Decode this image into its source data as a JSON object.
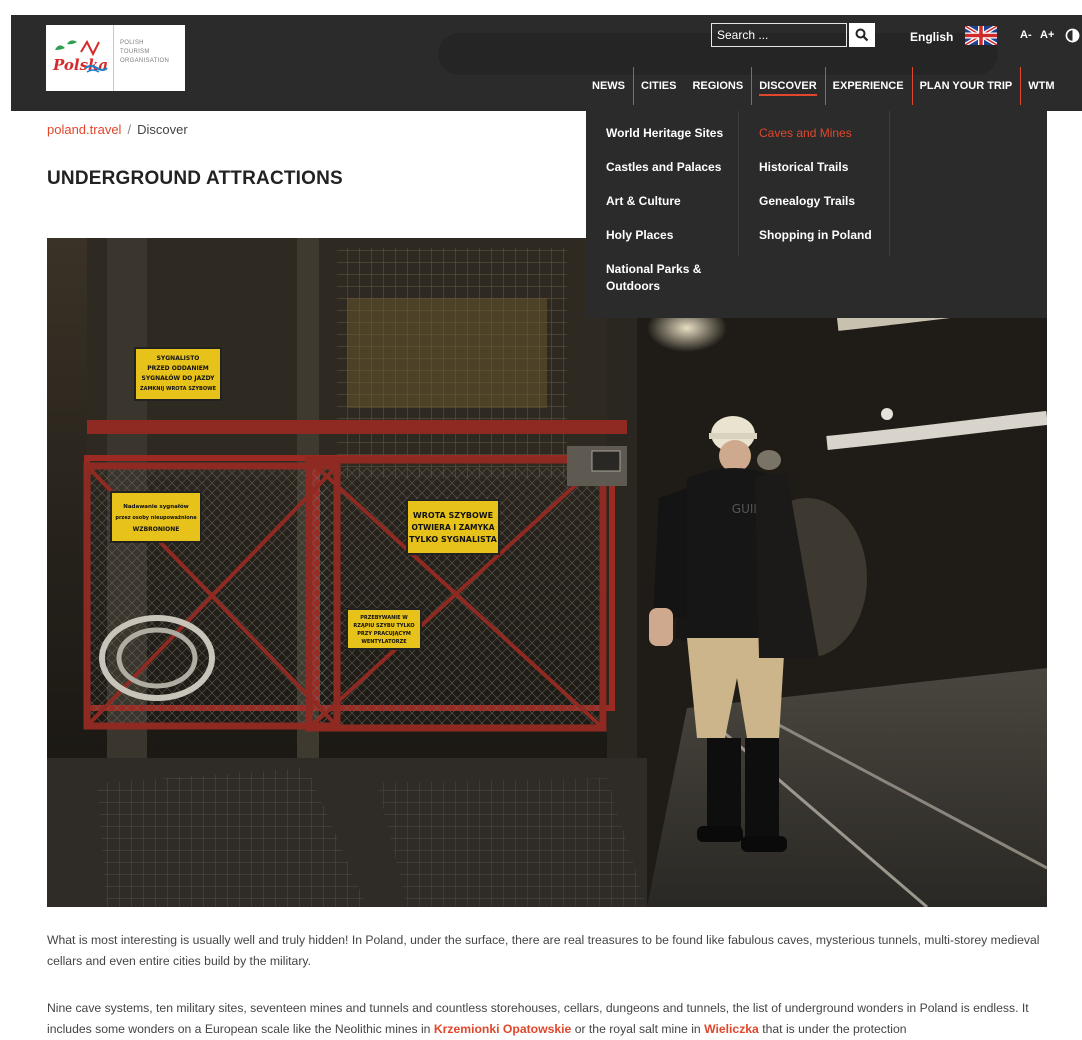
{
  "header": {
    "logo": {
      "brand_text": "Polska",
      "org_lines": [
        "POLISH",
        "TOURISM",
        "ORGANISATION"
      ]
    },
    "search": {
      "placeholder": "Search ...",
      "icon": "search-icon"
    },
    "language": "English",
    "language_flag_icon": "uk-flag-icon",
    "font_decrease": "A-",
    "font_increase": "A+",
    "contrast_icon": "contrast-icon",
    "nav": [
      "NEWS",
      "CITIES",
      "REGIONS",
      "DISCOVER",
      "EXPERIENCE",
      "PLAN YOUR TRIP",
      "WTM"
    ],
    "nav_active": "DISCOVER"
  },
  "dropdown": {
    "col1": [
      "World Heritage Sites",
      "Castles and Palaces",
      "Art & Culture",
      "Holy Places",
      "National Parks & Outdoors"
    ],
    "col2": [
      "Caves and Mines",
      "Historical Trails",
      "Genealogy Trails",
      "Shopping in Poland"
    ],
    "current": "Caves and Mines"
  },
  "breadcrumb": {
    "home": "poland.travel",
    "separator": "/",
    "current": "Discover"
  },
  "page_title": "UNDERGROUND ATTRACTIONS",
  "hero_signs": [
    [
      "SYGNALISTO",
      "PRZED ODDANIEM",
      "SYGNAŁÓW DO JAZDY",
      "ZAMKNIJ WROTA SZYBOWE"
    ],
    [
      "Nadawanie sygnałów",
      "przez osoby nieupoważnione",
      "WZBRONIONE"
    ],
    [
      "WROTA SZYBOWE",
      "OTWIERA I ZAMYKA",
      "TYLKO SYGNALISTA"
    ],
    [
      "PRZEBYWANIE W",
      "RZĄPIU SZYBU TYLKO",
      "PRZY PRACUJĄCYM",
      "WENTYLATORZE"
    ]
  ],
  "hero_jacket_text": "GUIDE",
  "paragraph1": "What is most interesting is usually well and truly hidden! In Poland, under the surface, there are real treasures to be found like fabulous caves, mysterious tunnels, multi-storey medieval cellars and even entire cities build by the military.",
  "paragraph2": {
    "part1": "Nine cave systems, ten military sites, seventeen mines and tunnels and countless storehouses, cellars, dungeons and tunnels, the list of underground wonders in Poland is endless. It includes some wonders on a European scale like the Neolithic mines in ",
    "link1": "Krzemionki Opatowskie",
    "part2": " or the royal salt mine in ",
    "link2": "Wieliczka",
    "part3": " that is under the protection"
  },
  "colors": {
    "accent": "#e0472b",
    "header_bg": "#2b2b2b",
    "sign_yellow": "#e6c21a",
    "gate_red": "#9a2a22"
  }
}
